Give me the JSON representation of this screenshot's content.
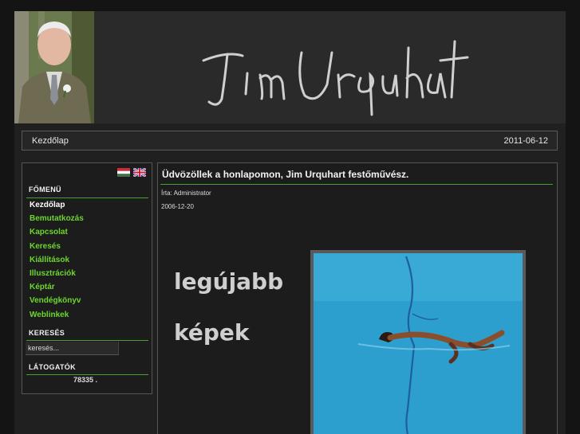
{
  "header": {
    "signature_text": "Jim Urquhart",
    "portrait": "photo of the painter"
  },
  "topbar": {
    "home_label": "Kezdőlap",
    "date": "2011-06-12"
  },
  "sidebar": {
    "languages": [
      "hungarian-flag-icon",
      "english-flag-icon"
    ],
    "main_menu_title": "FŐMENÜ",
    "menu_items": [
      {
        "label": "Kezdőlap",
        "active": true
      },
      {
        "label": "Bemutatkozás",
        "active": false
      },
      {
        "label": "Kapcsolat",
        "active": false
      },
      {
        "label": "Keresés",
        "active": false
      },
      {
        "label": "Kiállítások",
        "active": false
      },
      {
        "label": "Illusztrációk",
        "active": false
      },
      {
        "label": "Képtár",
        "active": false
      },
      {
        "label": "Vendégkönyv",
        "active": false
      },
      {
        "label": "Weblinkek",
        "active": false
      }
    ],
    "search_title": "KERESÉS",
    "search_placeholder": "keresés...",
    "visitors_title": "LÁTOGATÓK",
    "visitors_count": "78335 ."
  },
  "article": {
    "title": "Üdvözöllek a honlapomon, Jim Urquhart festőművész.",
    "author": "Írta: Administrator",
    "date": "2006-12-20",
    "promo_text": [
      "legújabb",
      "képek"
    ]
  },
  "colors": {
    "accent_green": "#6dd62e",
    "rule_green": "#4aa02c",
    "background": "#202020",
    "pool_blue": "#2b9fd0"
  }
}
